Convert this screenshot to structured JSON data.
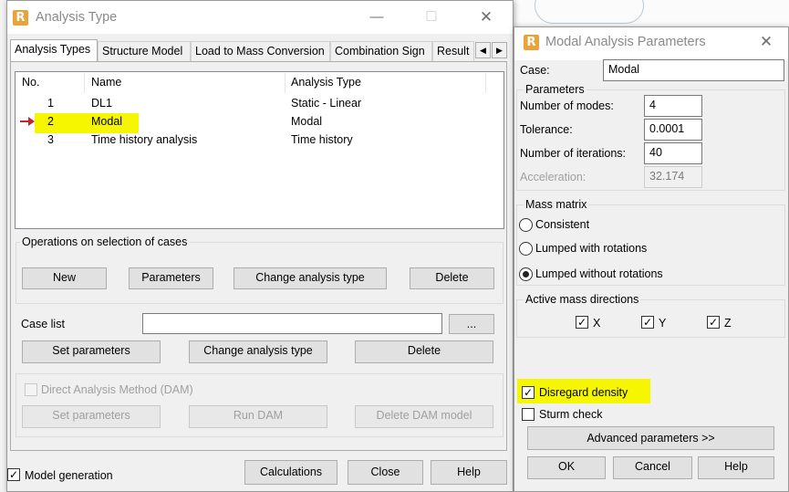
{
  "analysis_window": {
    "title": "Analysis Type",
    "tabs": [
      "Analysis Types",
      "Structure Model",
      "Load to Mass Conversion",
      "Combination Sign",
      "Result"
    ],
    "columns": [
      "No.",
      "Name",
      "Analysis Type"
    ],
    "rows": [
      {
        "no": "1",
        "name": "DL1",
        "type": "Static - Linear"
      },
      {
        "no": "2",
        "name": "Modal",
        "type": "Modal"
      },
      {
        "no": "3",
        "name": "Time history analysis",
        "type": "Time history"
      }
    ],
    "operations_group": "Operations on selection of cases",
    "ops_buttons": {
      "new": "New",
      "parameters": "Parameters",
      "change": "Change analysis type",
      "delete": "Delete"
    },
    "case_list_label": "Case list",
    "case_list_value": "",
    "browse_button": "...",
    "case_buttons": {
      "set_params": "Set parameters",
      "change": "Change analysis type",
      "delete": "Delete"
    },
    "dam_label": "Direct Analysis Method (DAM)",
    "dam_buttons": {
      "set_params": "Set parameters",
      "run": "Run DAM",
      "delete": "Delete DAM model"
    },
    "model_generation_label": "Model generation",
    "footer_buttons": {
      "calculations": "Calculations",
      "close": "Close",
      "help": "Help"
    }
  },
  "modal_window": {
    "title": "Modal Analysis Parameters",
    "case_label": "Case:",
    "case_value": "Modal",
    "parameters_group": "Parameters",
    "fields": {
      "modes_label": "Number of modes:",
      "modes_value": "4",
      "tolerance_label": "Tolerance:",
      "tolerance_value": "0.0001",
      "iterations_label": "Number of iterations:",
      "iterations_value": "40",
      "acceleration_label": "Acceleration:",
      "acceleration_value": "32.174"
    },
    "mass_matrix_group": "Mass matrix",
    "mass_options": [
      "Consistent",
      "Lumped with rotations",
      "Lumped without rotations"
    ],
    "mass_selected": "Lumped without rotations",
    "directions_group": "Active mass directions",
    "directions": [
      "X",
      "Y",
      "Z"
    ],
    "disregard_density_label": "Disregard density",
    "sturm_check_label": "Sturm check",
    "advanced_button": "Advanced parameters >>",
    "footer_buttons": {
      "ok": "OK",
      "cancel": "Cancel",
      "help": "Help"
    }
  },
  "colors": {
    "highlight": "#f6f600",
    "accent_logo": "#e8a33d",
    "arrow": "#c0282d"
  }
}
